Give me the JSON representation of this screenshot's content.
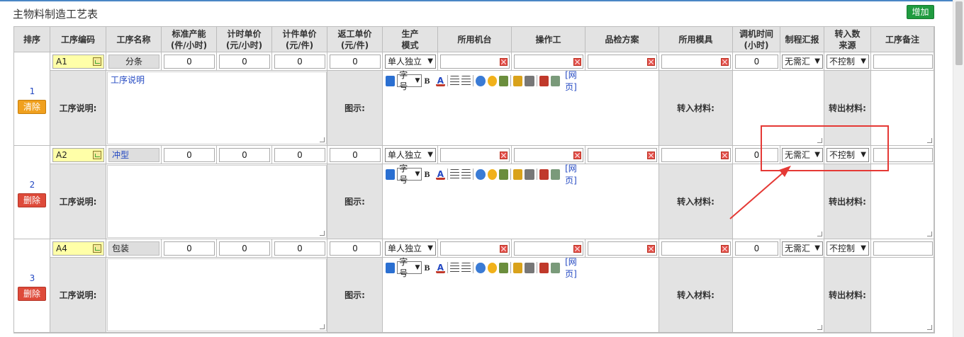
{
  "page_title": "主物料制造工艺表",
  "add_button": "增加",
  "headers": [
    "排序",
    "工序编码",
    "工序名称",
    "标准产能\n(件/小时)",
    "计时单价\n(元/小时)",
    "计件单价\n(元/件)",
    "返工单价\n(元/件)",
    "生产\n模式",
    "所用机台",
    "操作工",
    "品检方案",
    "所用模具",
    "调机时间\n(小时)",
    "制程汇报",
    "转入数\n来源",
    "工序备注"
  ],
  "labels": {
    "process_desc": "工序说明:",
    "diagram": "图示:",
    "input_material": "转入材料:",
    "output_material": "转出材料:"
  },
  "toolbar": {
    "font_size": "字号",
    "web": "[网页]"
  },
  "rows": [
    {
      "index": "1",
      "action": "清除",
      "code": "A1",
      "name": "分条",
      "std_capacity": "0",
      "hourly_price": "0",
      "piece_price": "0",
      "rework_price": "0",
      "mode": "单人独立",
      "report": "无需汇",
      "source": "不控制",
      "debug_time": "0",
      "desc": "工序说明"
    },
    {
      "index": "2",
      "action": "删除",
      "code": "A2",
      "name": "冲型",
      "std_capacity": "0",
      "hourly_price": "0",
      "piece_price": "0",
      "rework_price": "0",
      "mode": "单人独立",
      "report": "无需汇",
      "source": "不控制",
      "debug_time": "0",
      "desc": ""
    },
    {
      "index": "3",
      "action": "删除",
      "code": "A4",
      "name": "包装",
      "std_capacity": "0",
      "hourly_price": "0",
      "piece_price": "0",
      "rework_price": "0",
      "mode": "单人独立",
      "report": "无需汇",
      "source": "不控制",
      "debug_time": "0",
      "desc": ""
    }
  ]
}
